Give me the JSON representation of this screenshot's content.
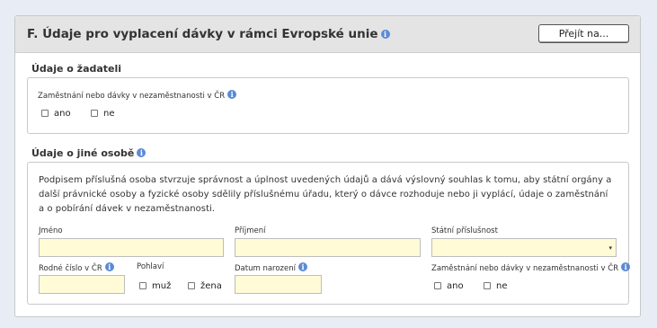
{
  "section": {
    "title": "F. Údaje pro vyplacení dávky v rámci Evropské unie",
    "info_icon": "info-icon",
    "goto_label": "Přejít na..."
  },
  "applicant": {
    "title": "Údaje o žadateli",
    "employment_label": "Zaměstnání nebo dávky v nezaměstnanosti v ČR",
    "yes": "ano",
    "no": "ne"
  },
  "other_person": {
    "title": "Údaje o jiné osobě",
    "paragraph": "Podpisem příslušná osoba stvrzuje správnost a úplnost uvedených údajů a dává výslovný souhlas k tomu, aby státní orgány a další právnické osoby a fyzické osoby sdělily příslušnému úřadu, který o dávce rozhoduje nebo ji vyplácí, údaje o zaměstnání a o pobírání dávek v nezaměstnanosti.",
    "first_name_label": "Jméno",
    "first_name_value": "",
    "last_name_label": "Příjmení",
    "last_name_value": "",
    "citizenship_label": "Státní příslušnost",
    "citizenship_value": "",
    "birth_number_label": "Rodné číslo v ČR",
    "birth_number_value": "",
    "gender_label": "Pohlaví",
    "male": "muž",
    "female": "žena",
    "birth_date_label": "Datum narození",
    "birth_date_value": "",
    "employment_label": "Zaměstnání nebo dávky v nezaměstnanosti v ČR",
    "yes": "ano",
    "no": "ne"
  },
  "colors": {
    "page_bg": "#e8edf5",
    "field_bg": "#fffbd6",
    "info_blue": "#5b8ad6"
  }
}
